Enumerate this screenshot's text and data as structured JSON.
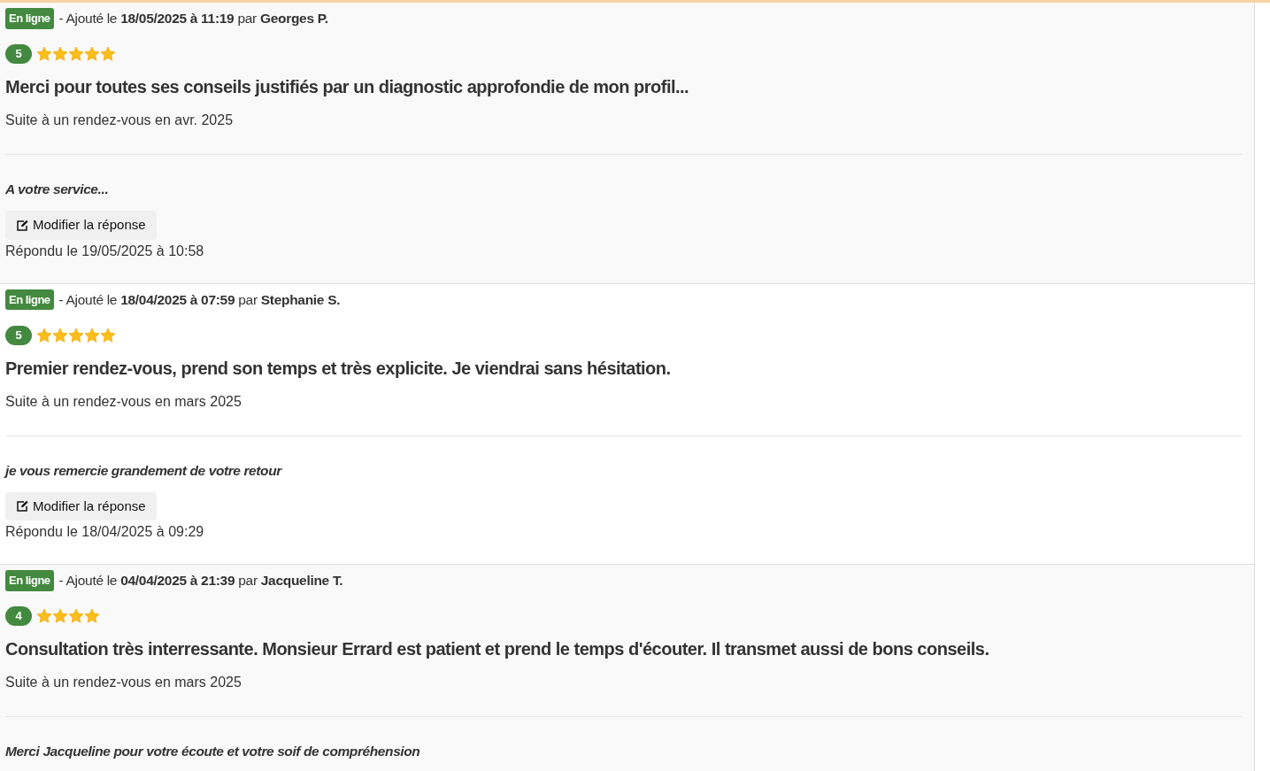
{
  "reviews": [
    {
      "status": "En ligne",
      "meta": "- Ajouté le **18/05/2025 à 11:19** par **Georges P.**",
      "rating": "5",
      "stars": 5,
      "title": "Merci pour toutes ses conseils justifiés par un diagnostic approfondie de mon profil...",
      "context": "Suite à un rendez-vous en avr. 2025",
      "reply": "A votre service...",
      "edit_button": "Modifier la réponse",
      "replied": "Répondu le 19/05/2025 à 10:58"
    },
    {
      "status": "En ligne",
      "meta": "- Ajouté le **18/04/2025 à 07:59** par **Stephanie S.**",
      "rating": "5",
      "stars": 5,
      "title": "Premier rendez-vous, prend son temps et très explicite. Je viendrai sans hésitation.",
      "context": "Suite à un rendez-vous en mars 2025",
      "reply": "je vous remercie grandement de votre retour",
      "edit_button": "Modifier la réponse",
      "replied": "Répondu le 18/04/2025 à 09:29"
    },
    {
      "status": "En ligne",
      "meta": "- Ajouté le **04/04/2025 à 21:39** par **Jacqueline T.**",
      "rating": "4",
      "stars": 4,
      "title": "Consultation très interressante. Monsieur Errard est patient et prend le temps d'écouter. Il transmet aussi de bons conseils.",
      "context": "Suite à un rendez-vous en mars 2025",
      "reply": "Merci Jacqueline pour votre écoute et votre soif de compréhension"
    }
  ]
}
